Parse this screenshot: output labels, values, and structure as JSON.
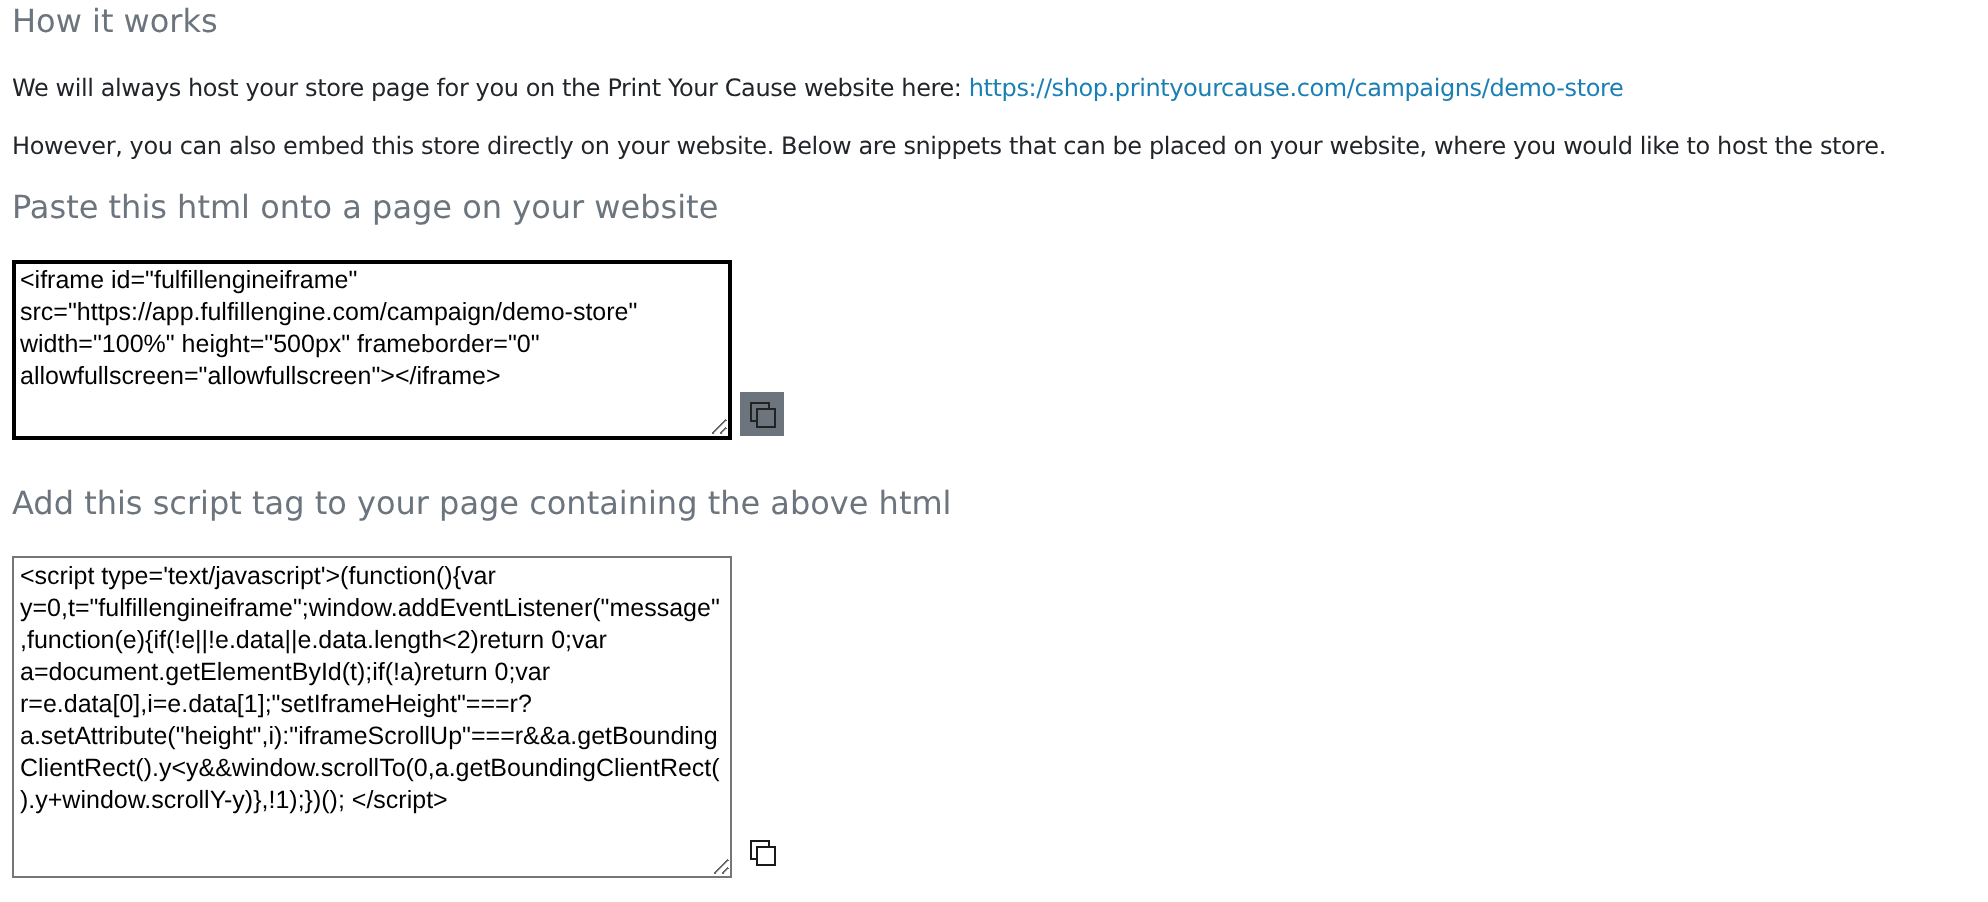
{
  "heading": "How it works",
  "intro": {
    "text": "We will always host your store page for you on the Print Your Cause website here:",
    "link": "https://shop.printyourcause.com/campaigns/demo-store"
  },
  "embed_note": "However, you can also embed this store directly on your website. Below are snippets that can be placed on your website, where you would like to host the store.",
  "snippets": [
    {
      "heading": "Paste this html onto a page on your website",
      "code": "<iframe id=\"fulfillengineiframe\" src=\"https://app.fulfillengine.com/campaign/demo-store\" width=\"100%\" height=\"500px\" frameborder=\"0\" allowfullscreen=\"allowfullscreen\"></iframe>",
      "focused": true,
      "copy_hovered": true
    },
    {
      "heading": "Add this script tag to your page containing the above html",
      "code": "<script type='text/javascript'>(function(){var y=0,t=\"fulfillengineiframe\";window.addEventListener(\"message\",function(e){if(!e||!e.data||e.data.length<2)return 0;var a=document.getElementById(t);if(!a)return 0;var r=e.data[0],i=e.data[1];\"setIframeHeight\"===r?a.setAttribute(\"height\",i):\"iframeScrollUp\"===r&&a.getBoundingClientRect().y<y&&window.scrollTo(0,a.getBoundingClientRect().y+window.scrollY-y)},!1);})(); </script>",
      "focused": false,
      "copy_hovered": false
    }
  ]
}
